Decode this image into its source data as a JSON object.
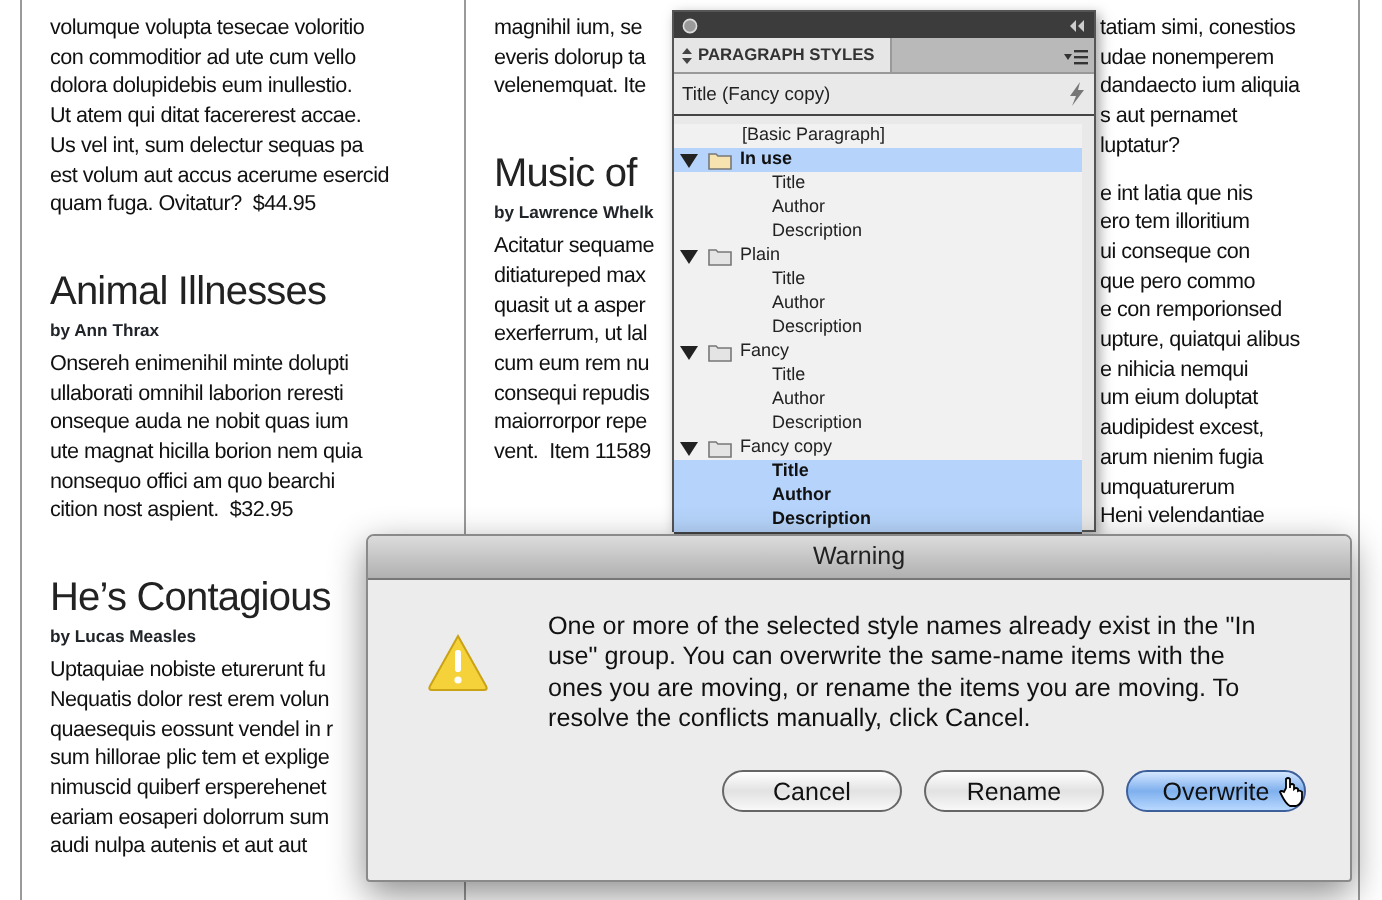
{
  "document": {
    "columns": [
      {
        "blocks": [
          {
            "kind": "body",
            "lines": [
              "volumque volupta tesecae voloritio",
              "con commoditior ad ute cum vello",
              "dolora dolupidebis eum inullestio.",
              "Ut atem qui ditat facererest accae.",
              "Us vel int, sum delectur sequas pa",
              "est volum aut accus acerume esercid",
              "quam fuga. Ovitatur?  $44.95"
            ]
          },
          {
            "kind": "heading",
            "text": "Animal Illnesses"
          },
          {
            "kind": "byline",
            "text": "by Ann Thrax"
          },
          {
            "kind": "body",
            "lines": [
              "Onsereh enimenihil minte dolupti",
              "ullaborati omnihil laborion reresti",
              "onseque auda ne nobit quas ium",
              "ute magnat hicilla borion nem quia",
              "nonsequo offici am quo bearchi",
              "cition nost aspient.  $32.95"
            ]
          },
          {
            "kind": "heading",
            "text": "He’s Contagious"
          },
          {
            "kind": "byline",
            "text": "by Lucas Measles"
          },
          {
            "kind": "body",
            "lines": [
              "Uptaquiae nobiste eturerunt fu",
              "Nequatis dolor rest erem volun",
              "quaesequis eossunt vendel in r",
              "sum hillorae plic tem et explige",
              "nimuscid quiberf ersperehenet",
              "eariam eosaperi dolorrum sum",
              "audi nulpa autenis et aut aut"
            ]
          }
        ]
      },
      {
        "blocks": [
          {
            "kind": "body",
            "lines": [
              "magnihil ium, se",
              "everis dolorup ta",
              "velenemquat. Ite"
            ]
          },
          {
            "kind": "heading",
            "text": "Music of"
          },
          {
            "kind": "byline",
            "text": "by Lawrence Whelk"
          },
          {
            "kind": "body",
            "lines": [
              "Acitatur sequame",
              "ditiatureped max",
              "quasit ut a asper",
              "exerferrum, ut lal",
              "cum eum rem nu",
              "consequi repudis",
              "maiorrorpor repe",
              "vent.  Item 11589"
            ]
          }
        ]
      },
      {
        "blocks": [
          {
            "kind": "body",
            "lines": [
              "tatiam simi, conestios",
              "udae nonemperem",
              "dandaecto ium aliquia",
              "s aut pernamet",
              "luptatur?"
            ]
          },
          {
            "kind": "body",
            "lines": [
              "e int latia que nis",
              "ero tem illoritium",
              "ui conseque con",
              "que pero commo",
              "e con remporionsed",
              "upture, quiatqui alibus",
              "e nihicia nemqui",
              "um eium doluptat",
              "audipidest excest,",
              "arum nienim fugia",
              "umquaturerum",
              "Heni velendantiae"
            ]
          }
        ]
      }
    ]
  },
  "panel": {
    "tab": "PARAGRAPH STYLES",
    "current_style": "Title (Fancy copy)",
    "styles": [
      {
        "kind": "style",
        "label": "[Basic Paragraph]",
        "selected": false
      },
      {
        "kind": "group",
        "label": "In use",
        "selected": true,
        "expanded": true,
        "children": [
          {
            "label": "Title",
            "selected": false
          },
          {
            "label": "Author",
            "selected": false
          },
          {
            "label": "Description",
            "selected": false
          }
        ]
      },
      {
        "kind": "group",
        "label": "Plain",
        "selected": false,
        "expanded": true,
        "children": [
          {
            "label": "Title",
            "selected": false
          },
          {
            "label": "Author",
            "selected": false
          },
          {
            "label": "Description",
            "selected": false
          }
        ]
      },
      {
        "kind": "group",
        "label": "Fancy",
        "selected": false,
        "expanded": true,
        "children": [
          {
            "label": "Title",
            "selected": false
          },
          {
            "label": "Author",
            "selected": false
          },
          {
            "label": "Description",
            "selected": false
          }
        ]
      },
      {
        "kind": "group",
        "label": "Fancy copy",
        "selected": false,
        "expanded": true,
        "children": [
          {
            "label": "Title",
            "selected": true
          },
          {
            "label": "Author",
            "selected": true
          },
          {
            "label": "Description",
            "selected": true
          }
        ]
      }
    ]
  },
  "dialog": {
    "title": "Warning",
    "message": "One or more of the selected style names already exist in the \"In use\" group. You can overwrite the same-name items with the ones you are moving, or rename the items you are moving. To resolve the conflicts manually, click Cancel.",
    "buttons": [
      {
        "label": "Cancel",
        "default": false
      },
      {
        "label": "Rename",
        "default": false
      },
      {
        "label": "Overwrite",
        "default": true
      }
    ]
  }
}
